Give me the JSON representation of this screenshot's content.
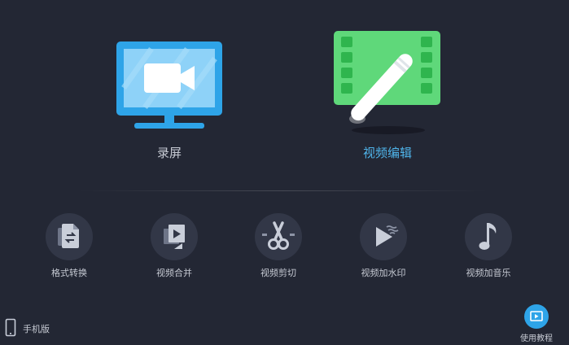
{
  "main_features": {
    "record": {
      "label": "录屏",
      "icon": "monitor-video-icon",
      "color": "#2ea4e8"
    },
    "edit": {
      "label": "视频编辑",
      "icon": "film-pen-icon",
      "color": "#5fd87a",
      "label_color": "#4fb4ea"
    }
  },
  "tools": [
    {
      "label": "格式转换",
      "icon": "format-convert-icon"
    },
    {
      "label": "视频合并",
      "icon": "video-merge-icon"
    },
    {
      "label": "视频剪切",
      "icon": "scissors-icon"
    },
    {
      "label": "视频加水印",
      "icon": "play-watermark-icon"
    },
    {
      "label": "视频加音乐",
      "icon": "music-note-icon"
    }
  ],
  "footer": {
    "mobile_label": "手机版",
    "tutorial_label": "使用教程"
  },
  "colors": {
    "background": "#232734",
    "tool_circle": "#323747",
    "accent": "#2ea4e8"
  }
}
